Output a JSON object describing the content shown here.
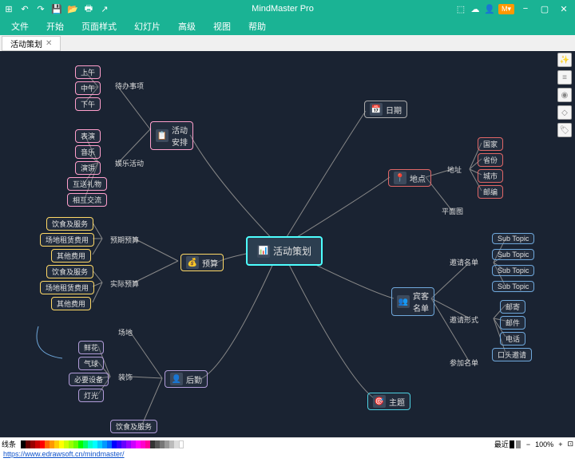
{
  "app": {
    "title": "MindMaster Pro",
    "badge": "M▾"
  },
  "menu": {
    "items": [
      "文件",
      "开始",
      "页面样式",
      "幻灯片",
      "高级",
      "视图",
      "帮助"
    ]
  },
  "tab": {
    "label": "活动策划"
  },
  "status": {
    "left": "线条",
    "right": "最近",
    "zoom": "100%"
  },
  "footer": {
    "link": "https://www.edrawsoft.cn/mindmaster/"
  },
  "mind": {
    "center": "活动策划",
    "b1": {
      "title": "活动\n安排",
      "sub1": "待办事项",
      "sub2": "娱乐活动",
      "leaves1": [
        "上午",
        "中午",
        "下午"
      ],
      "leaves2": [
        "表演",
        "音乐",
        "演讲",
        "互送礼物",
        "相互交流"
      ]
    },
    "b2": {
      "title": "预算",
      "sub1": "预期预算",
      "sub2": "实际预算",
      "leaves1": [
        "饮食及服务",
        "场地租赁费用",
        "其他费用"
      ],
      "leaves2": [
        "饮食及服务",
        "场地租赁费用",
        "其他费用"
      ]
    },
    "b3": {
      "title": "后勤",
      "sub1": "场地",
      "sub2": "装饰",
      "sub3": "饮食及服务",
      "leaves2": [
        "鲜花",
        "气球",
        "必要设备",
        "灯光"
      ]
    },
    "b4": {
      "title": "日期"
    },
    "b5": {
      "title": "地点",
      "sub1": "地址",
      "sub2": "平面图",
      "leaves1": [
        "国家",
        "省份",
        "城市",
        "邮编"
      ]
    },
    "b6": {
      "title": "宾客\n名单",
      "sub1": "邀请名单",
      "sub2": "邀请形式",
      "sub3": "参加名单",
      "leaves1": [
        "Sub Topic",
        "Sub Topic",
        "Sub Topic",
        "Sub Topic"
      ],
      "leaves2": [
        "邮寄",
        "邮件",
        "电话",
        "口头邀请"
      ]
    },
    "b7": {
      "title": "主题"
    }
  }
}
